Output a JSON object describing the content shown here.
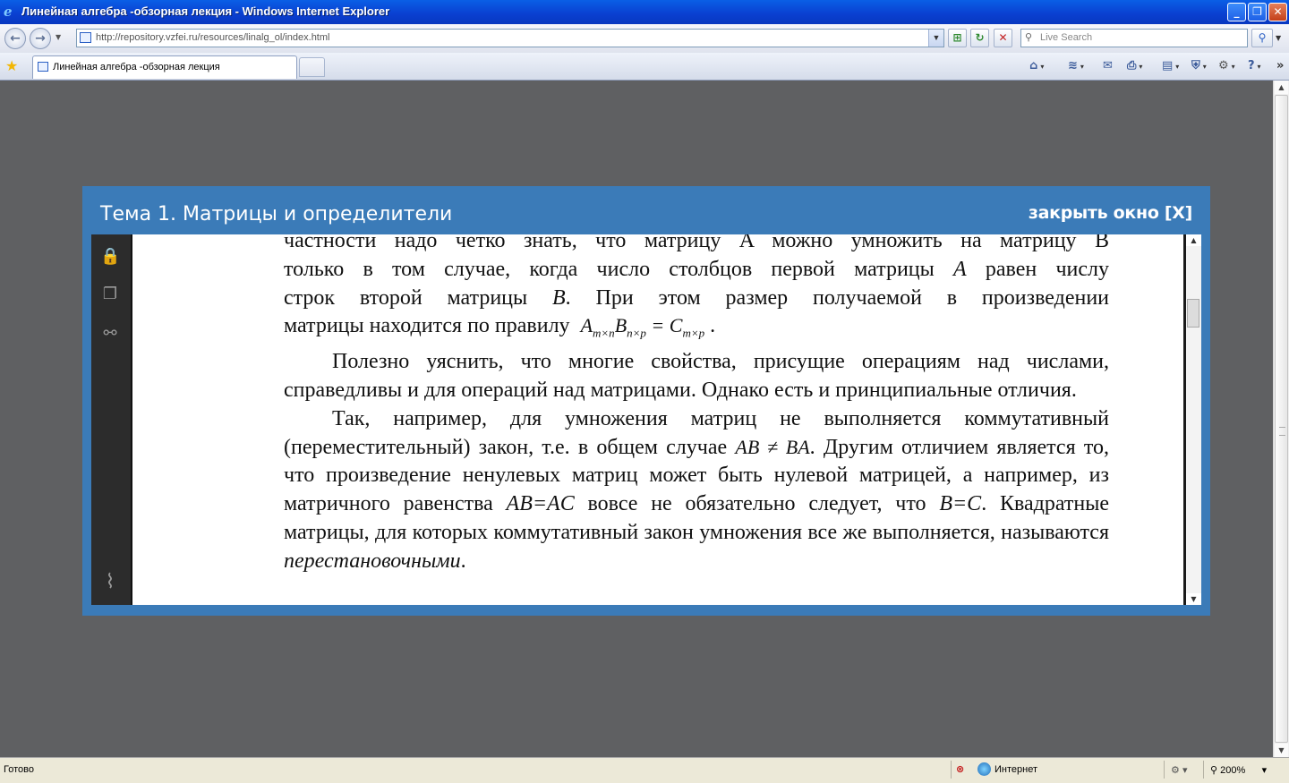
{
  "window": {
    "title": "Линейная алгебра -обзорная лекция - Windows Internet Explorer",
    "logo_glyph": "e",
    "buttons": {
      "minimize": "_",
      "maximize": "❐",
      "close": "✕"
    }
  },
  "address_bar": {
    "back_glyph": "←",
    "forward_glyph": "→",
    "url": "http://repository.vzfei.ru/resources/linalg_ol/index.html",
    "dropdown_glyph": "▼",
    "compat_glyph": "⊞",
    "refresh_glyph": "↻",
    "stop_glyph": "✕",
    "search_placeholder": "Live Search",
    "search_glyph": "⚲",
    "search_go_glyph": "⚲"
  },
  "tabs": [
    {
      "label": "Линейная алгебра -обзорная лекция"
    }
  ],
  "favorites_glyph": "★",
  "command_bar": {
    "home_glyph": "⌂",
    "feeds_glyph": "≋",
    "mail_glyph": "✉",
    "print_glyph": "⎙",
    "page_glyph": "▤",
    "safety_glyph": "⛨",
    "tools_glyph": "⚙",
    "help_glyph": "?",
    "more_glyph": "»",
    "arrow_glyph": "▾"
  },
  "lecture": {
    "title": "Тема 1. Матрицы и определители",
    "close_link": "закрыть окно [X]"
  },
  "pdf_sidebar": {
    "lock_glyph": "🔒",
    "pages_glyph": "❐",
    "search_glyph": "⚯",
    "attach_glyph": "⌇"
  },
  "pdf_scroll": {
    "up": "▲",
    "down": "▼"
  },
  "content": {
    "p1": {
      "l1": "частности надо четко знать, что матрицу A можно умножить на матрицу B",
      "l2a": "только в том случае, когда число столбцов первой матрицы ",
      "l2var": "A",
      "l2b": " равен числу",
      "l3a": "строк второй матрицы ",
      "l3var": "B",
      "l3b": ". При этом размер получаемой в произведении",
      "l4": "матрицы находится по правилу",
      "formula": {
        "a": "A",
        "a_sub": "m×n",
        "b": "B",
        "b_sub": "n×p",
        "eq": " = ",
        "c": "C",
        "c_sub": "m×p",
        "end": "."
      }
    },
    "p2": "Полезно уяснить, что многие свойства, присущие операциям над числами, справедливы и для операций над матрицами. Однако есть и принципиальные отличия.",
    "p3": {
      "t1": "Так, например, для умножения матриц не выполняется коммутативный (переместительный) закон, т.е. в общем случае ",
      "f1": "AB ≠ BA",
      "t2": ". Другим отличием является то, что произведение ненулевых матриц может быть нулевой матрицей, а например, из матричного равенства ",
      "f2": "AB=AC",
      "t3": " вовсе не обязательно следует, что ",
      "f3": "B=C",
      "t4": ". Квадратные матрицы, для которых коммутативный закон умножения все же выполняется, называются ",
      "em": "перестановочными",
      "t5": "."
    }
  },
  "page_scroll": {
    "up": "▲",
    "down": "▼"
  },
  "status": {
    "text": "Готово",
    "error_glyph": "⊗",
    "zone": "Интернет",
    "protected_glyph": "⚙",
    "zoom": "200%",
    "arrow_glyph": "▾"
  }
}
